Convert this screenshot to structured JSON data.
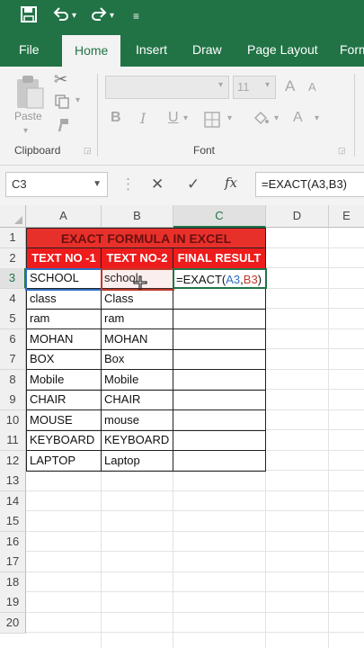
{
  "qat": {
    "save_icon": "save-icon",
    "undo_icon": "undo-icon",
    "redo_icon": "redo-icon",
    "customize_icon": "customize-icon"
  },
  "tabs": [
    "File",
    "Home",
    "Insert",
    "Draw",
    "Page Layout",
    "Form"
  ],
  "ribbon": {
    "clipboard": {
      "paste_label": "Paste",
      "group_label": "Clipboard"
    },
    "font": {
      "font_size": "11",
      "group_label": "Font",
      "bold": "B",
      "italic": "I",
      "underline": "U",
      "grow": "A",
      "shrink": "A"
    }
  },
  "formula_bar": {
    "name_box": "C3",
    "cancel": "✕",
    "enter": "✓",
    "fx": "fx",
    "formula": "=EXACT(A3,B3)"
  },
  "grid": {
    "columns": [
      "A",
      "B",
      "C",
      "D",
      "E"
    ],
    "rows": [
      "1",
      "2",
      "3",
      "4",
      "5",
      "6",
      "7",
      "8",
      "9",
      "10",
      "11",
      "12",
      "13",
      "14",
      "15",
      "16",
      "17",
      "18",
      "19",
      "20"
    ],
    "title": "EXACT FORMULA IN EXCEL",
    "headers": [
      "TEXT NO -1",
      "TEXT NO-2",
      "FINAL RESULT"
    ],
    "data": [
      [
        "SCHOOL",
        "school"
      ],
      [
        "class",
        "Class"
      ],
      [
        "ram",
        "ram"
      ],
      [
        "MOHAN",
        "MOHAN"
      ],
      [
        "BOX",
        "Box"
      ],
      [
        "Mobile",
        "Mobile"
      ],
      [
        "CHAIR",
        "CHAIR"
      ],
      [
        "MOUSE",
        "mouse"
      ],
      [
        "KEYBOARD",
        "KEYBOARD"
      ],
      [
        "LAPTOP",
        "Laptop"
      ]
    ],
    "formula_parts": {
      "prefix": "=EXACT(",
      "ref_a": "A3",
      "comma": ",",
      "ref_b": "B3",
      "suffix": ")"
    },
    "ref_colors": {
      "a": "#2f6fc4",
      "b": "#c0392b"
    },
    "accent": "#217346"
  }
}
